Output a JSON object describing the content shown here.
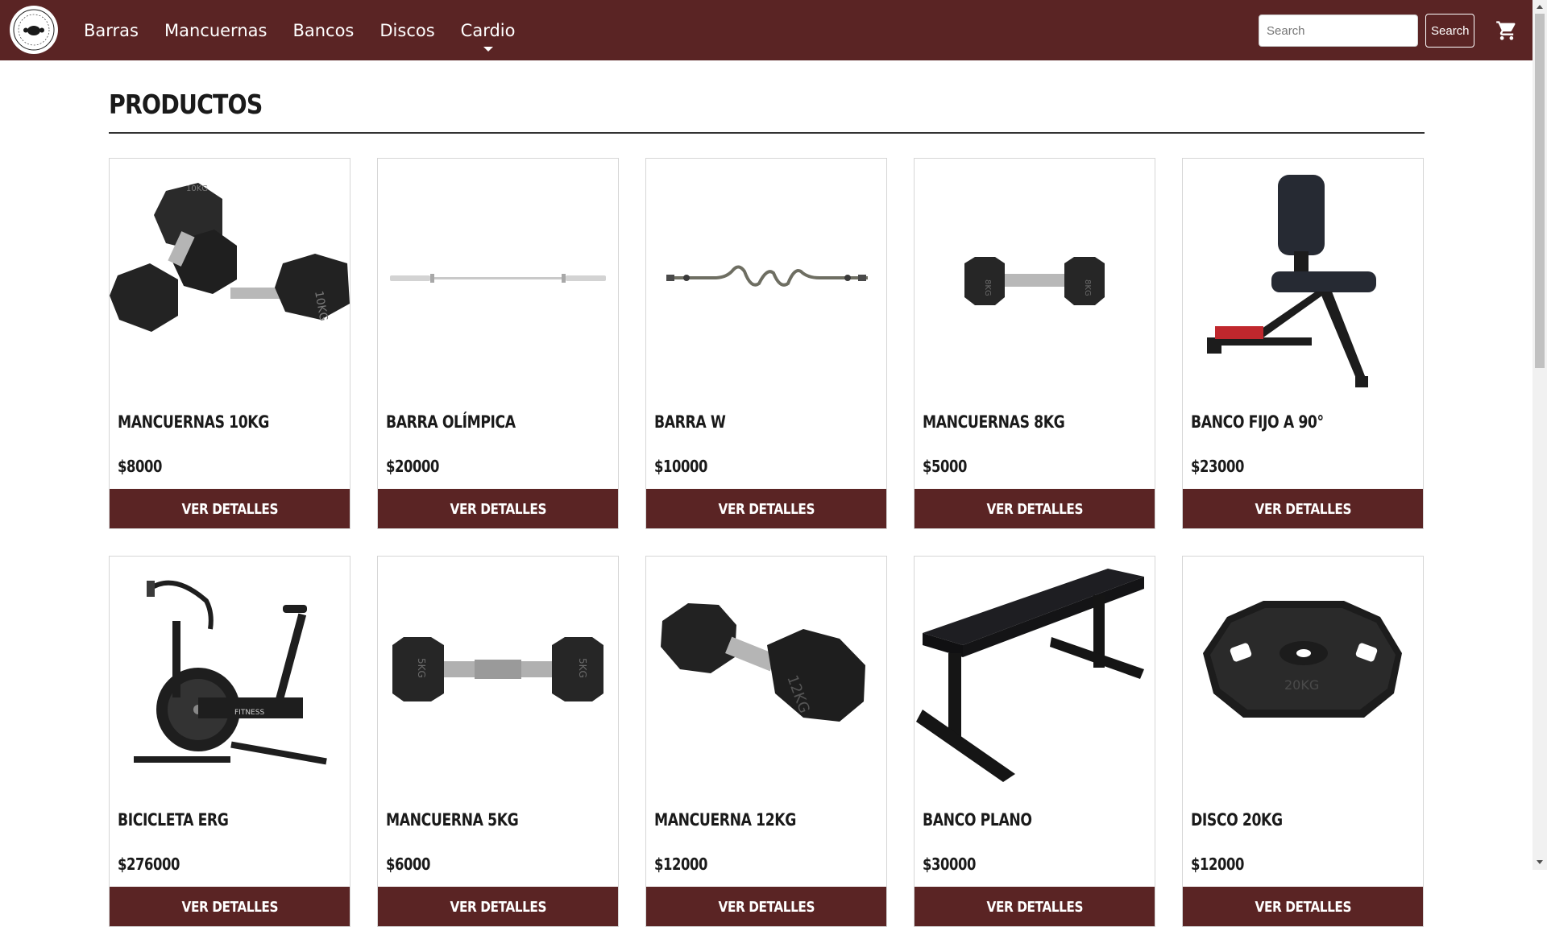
{
  "navbar": {
    "logo_alt": "Fitness slogan",
    "links": [
      "Barras",
      "Mancuernas",
      "Bancos",
      "Discos",
      "Cardio"
    ],
    "search_placeholder": "Search",
    "search_button": "Search",
    "cart_icon": "shopping-cart-icon",
    "bg_color": "#5a2424"
  },
  "main": {
    "title": "Productos"
  },
  "products": [
    {
      "name": "Mancuernas 10kg",
      "price": "$8000",
      "button": "Ver detalles",
      "image": "dumbbell-pair"
    },
    {
      "name": "Barra Olímpica",
      "price": "$20000",
      "button": "Ver detalles",
      "image": "olympic-bar"
    },
    {
      "name": "Barra W",
      "price": "$10000",
      "button": "Ver detalles",
      "image": "ez-curl-bar"
    },
    {
      "name": "Mancuernas 8kg",
      "price": "$5000",
      "button": "Ver detalles",
      "image": "dumbbell-small"
    },
    {
      "name": "Banco fijo a 90°",
      "price": "$23000",
      "button": "Ver detalles",
      "image": "utility-bench"
    },
    {
      "name": "Bicicleta Erg",
      "price": "$276000",
      "button": "Ver detalles",
      "image": "air-bike"
    },
    {
      "name": "Mancuerna 5kg",
      "price": "$6000",
      "button": "Ver detalles",
      "image": "dumbbell-5kg"
    },
    {
      "name": "Mancuerna 12kg",
      "price": "$12000",
      "button": "Ver detalles",
      "image": "dumbbell-12kg"
    },
    {
      "name": "Banco plano",
      "price": "$30000",
      "button": "Ver detalles",
      "image": "flat-bench"
    },
    {
      "name": "Disco 20kg",
      "price": "$12000",
      "button": "Ver detalles",
      "image": "weight-plate"
    }
  ],
  "image_labels": {
    "d10_a": "10KG",
    "d10_b": "10KG",
    "d8_a": "8KG",
    "d8_b": "8KG",
    "d5_a": "5KG",
    "d5_b": "5KG",
    "d12": "12KG",
    "plate": "20KG",
    "bike_brand": "FITNESS"
  }
}
